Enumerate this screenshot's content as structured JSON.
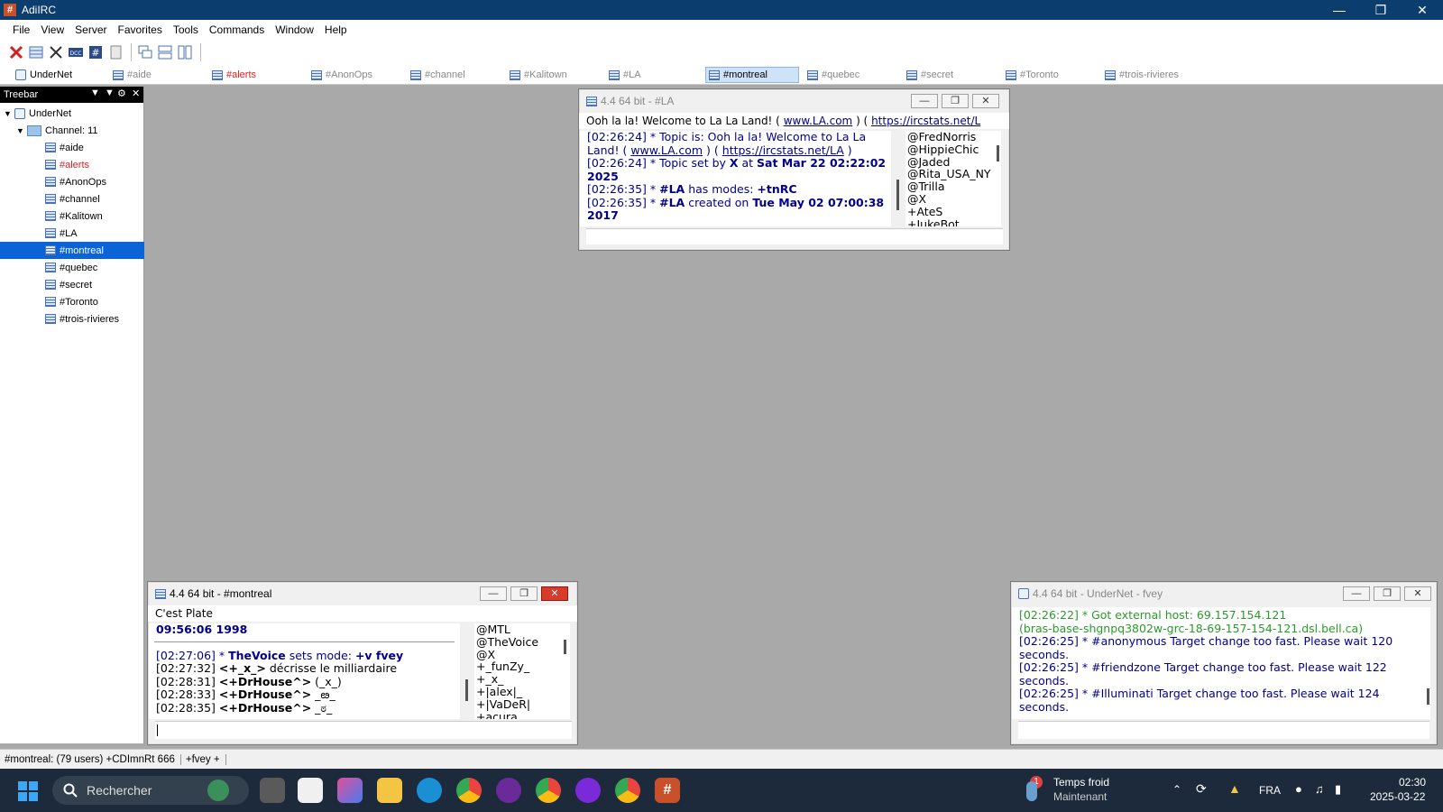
{
  "app": {
    "title": "AdiIRC"
  },
  "menu": [
    "File",
    "View",
    "Server",
    "Favorites",
    "Tools",
    "Commands",
    "Window",
    "Help"
  ],
  "switchbar": {
    "tabs": [
      {
        "label": "UnderNet",
        "type": "server"
      },
      {
        "label": "#aide",
        "type": "channel"
      },
      {
        "label": "#alerts",
        "type": "alert"
      },
      {
        "label": "#AnonOps",
        "type": "channel"
      },
      {
        "label": "#channel",
        "type": "channel"
      },
      {
        "label": "#Kalitown",
        "type": "channel"
      },
      {
        "label": "#LA",
        "type": "channel"
      },
      {
        "label": "#montreal",
        "type": "active"
      },
      {
        "label": "#quebec",
        "type": "channel"
      },
      {
        "label": "#secret",
        "type": "channel"
      },
      {
        "label": "#Toronto",
        "type": "channel"
      },
      {
        "label": "#trois-rivieres",
        "type": "channel"
      }
    ]
  },
  "treebar": {
    "header": "Treebar",
    "server": "UnderNet",
    "folder": "Channel: 11",
    "channels": [
      {
        "label": "#aide",
        "state": "normal"
      },
      {
        "label": "#alerts",
        "state": "alert"
      },
      {
        "label": "#AnonOps",
        "state": "normal"
      },
      {
        "label": "#channel",
        "state": "normal"
      },
      {
        "label": "#Kalitown",
        "state": "normal"
      },
      {
        "label": "#LA",
        "state": "normal"
      },
      {
        "label": "#montreal",
        "state": "selected"
      },
      {
        "label": "#quebec",
        "state": "normal"
      },
      {
        "label": "#secret",
        "state": "normal"
      },
      {
        "label": "#Toronto",
        "state": "normal"
      },
      {
        "label": "#trois-rivieres",
        "state": "normal"
      }
    ]
  },
  "win_la": {
    "title": "4.4 64 bit - #LA",
    "topic_text": "Ooh la la! Welcome to La La Land! ( ",
    "topic_link1": "www.LA.com",
    "topic_mid": " ) ( ",
    "topic_link2": "https://ircstats.net/L",
    "lines": [
      "[02:26:24] * Topic is: Ooh la la! Welcome to La La",
      "Land! ( www.LA.com ) ( https://ircstats.net/LA )",
      "[02:26:24] * Topic set by X at Sat Mar 22 02:22:02",
      "2025",
      "[02:26:35] * #LA has modes: +tnRC",
      "[02:26:35] * #LA created on Tue May 02 07:00:38",
      "2017"
    ],
    "nicks": [
      "@FredNorris",
      "@HippieChic",
      "@Jaded",
      "@Rita_USA_NY",
      "@Trilla",
      "@X",
      "+AteS",
      "+JukeBot"
    ]
  },
  "win_montreal": {
    "title": "4.4 64 bit - #montreal",
    "topic": "C'est Plate",
    "lines": [
      "09:56:06 1998",
      "",
      "[02:27:06] * TheVoice sets mode: +v fvey",
      "[02:27:32] <+_x_> décrisse le milliardaire",
      "[02:28:31] <+DrHouse^> (_x_)",
      "[02:28:33] <+DrHouse^> _ఴ_",
      "[02:28:35] <+DrHouse^> _ಠ_"
    ],
    "nicks": [
      "@MTL",
      "@TheVoice",
      "@X",
      "+_funZy_",
      "+_x_",
      "+|alex|_",
      "+|VaDeR|",
      "+acura"
    ]
  },
  "win_server": {
    "title": "4.4 64 bit - UnderNet - fvey",
    "lines": [
      {
        "text": "[02:26:22] * Got external host: 69.157.154.121",
        "color": "green"
      },
      {
        "text": "(bras-base-shgnpq3802w-grc-18-69-157-154-121.dsl.bell.ca)",
        "color": "green"
      },
      {
        "text": "[02:26:25] * #anonymous Target change too fast. Please wait 120",
        "color": "blue"
      },
      {
        "text": "seconds.",
        "color": "blue"
      },
      {
        "text": "[02:26:25] * #friendzone Target change too fast. Please wait 122",
        "color": "blue"
      },
      {
        "text": "seconds.",
        "color": "blue"
      },
      {
        "text": "[02:26:25] * #Illuminati Target change too fast. Please wait 124",
        "color": "blue"
      },
      {
        "text": "seconds.",
        "color": "blue"
      }
    ]
  },
  "statusbar": {
    "channel_info": "#montreal: (79 users) +CDImnRt 666",
    "mode": "+fvey +"
  },
  "taskbar": {
    "search_placeholder": "Rechercher",
    "weather_title": "Temps froid",
    "weather_sub": "Maintenant",
    "notification_count": "1",
    "language": "FRA",
    "time": "02:30",
    "date": "2025-03-22"
  }
}
